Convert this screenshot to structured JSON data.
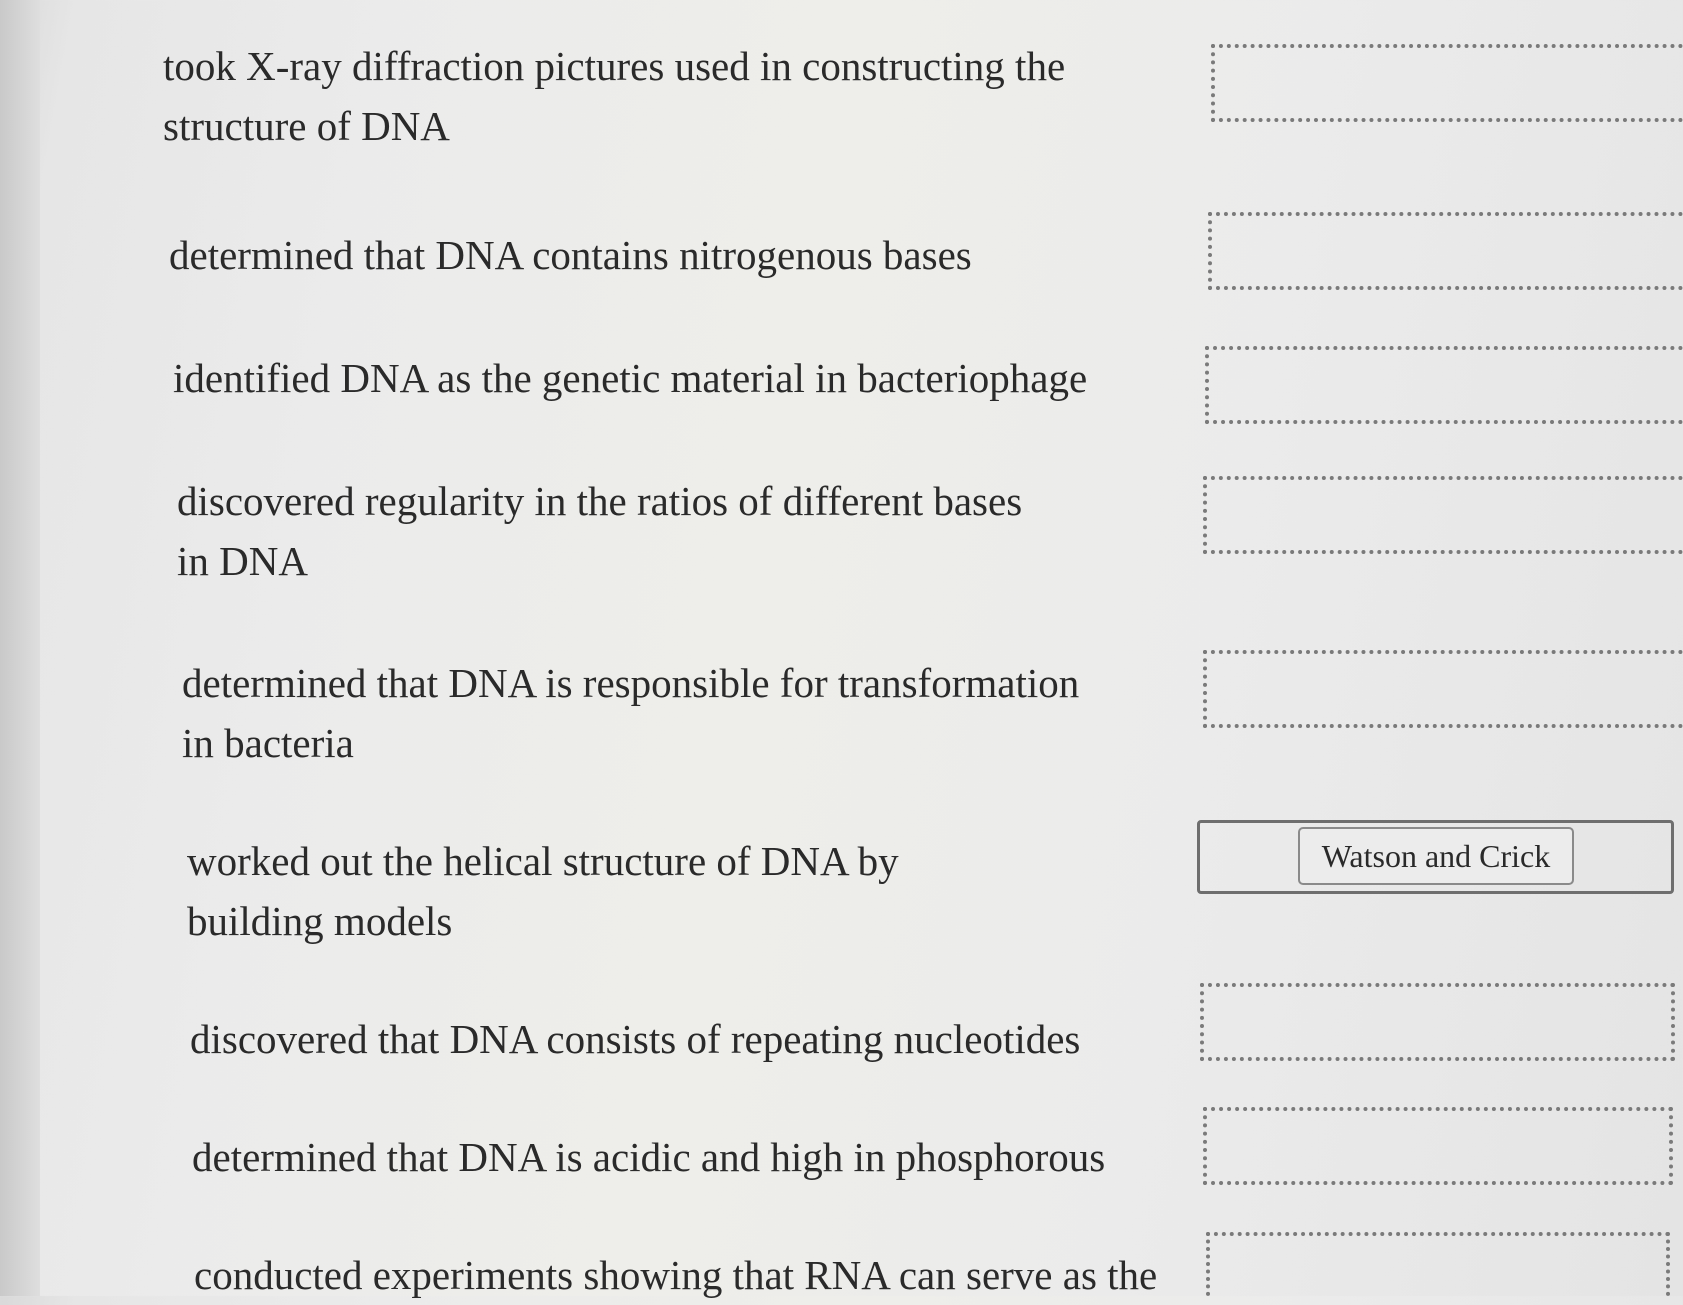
{
  "items": [
    {
      "lines": [
        "took X-ray diffraction pictures used in constructing the",
        "structure of DNA"
      ],
      "answer": ""
    },
    {
      "lines": [
        "determined that DNA contains nitrogenous bases"
      ],
      "answer": ""
    },
    {
      "lines": [
        "identified DNA as the genetic material in bacteriophage"
      ],
      "answer": ""
    },
    {
      "lines": [
        "discovered regularity in the ratios of different bases",
        "in DNA"
      ],
      "answer": ""
    },
    {
      "lines": [
        "determined that DNA is responsible for transformation",
        "in bacteria"
      ],
      "answer": ""
    },
    {
      "lines": [
        "worked out the helical structure of DNA by",
        "building models"
      ],
      "answer": "Watson and Crick"
    },
    {
      "lines": [
        "discovered that DNA consists of repeating nucleotides"
      ],
      "answer": ""
    },
    {
      "lines": [
        "determined that DNA is acidic and high in phosphorous"
      ],
      "answer": ""
    },
    {
      "lines": [
        "conducted experiments showing that RNA can serve as the"
      ],
      "answer": ""
    }
  ],
  "colors": {
    "background": "#ebebeb",
    "text": "#2a2a2a",
    "drop_border": "#7a7a7a"
  }
}
